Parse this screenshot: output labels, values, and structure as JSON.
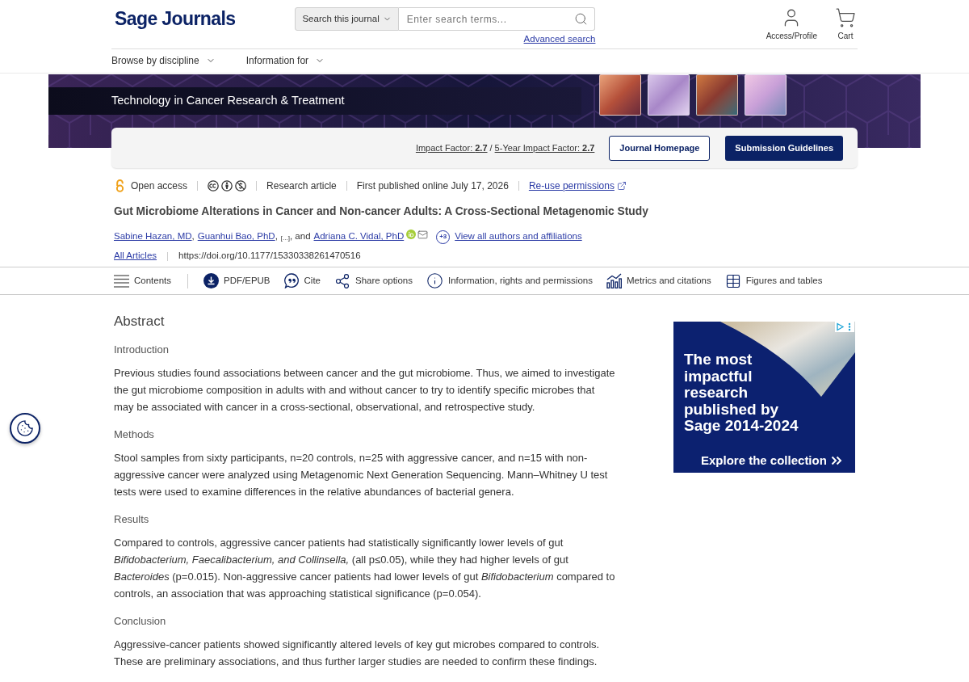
{
  "header": {
    "logo": "Sage Journals",
    "search": {
      "scope": "Search this journal",
      "placeholder": "Enter search terms..."
    },
    "advanced_search": "Advanced search",
    "actions": [
      {
        "kind": "profile",
        "label": "Access/Profile"
      },
      {
        "kind": "cart",
        "label": "Cart"
      }
    ]
  },
  "nav": [
    {
      "label": "Browse by discipline"
    },
    {
      "label": "Information for"
    }
  ],
  "banner": {
    "journal_title": "Technology in Cancer Research & Treatment",
    "metrics": [
      "Impact Factor: **2.7**",
      "5-Year Impact Factor: **2.7**"
    ],
    "metrics_separator": "/",
    "buttons": [
      {
        "kind": "outline",
        "label": "Journal Homepage"
      },
      {
        "kind": "primary",
        "label": "Submission Guidelines"
      }
    ]
  },
  "article_meta": {
    "access": "Open access",
    "type": "Research article",
    "published": "First published online July 17, 2026",
    "permissions": "Re-use permissions"
  },
  "title": "Gut Microbiome Alterations in Cancer and Non-cancer Adults: A Cross-Sectional Metagenomic Study",
  "author_line": [
    {
      "kind": "author",
      "text": "Sabine Hazan, MD"
    },
    {
      "kind": "text",
      "text": ","
    },
    {
      "kind": "author",
      "text": "Guanhui Bao, PhD"
    },
    {
      "kind": "text",
      "text": ","
    },
    {
      "kind": "collapsed",
      "text": "[...]"
    },
    {
      "kind": "text",
      "text": ", and"
    },
    {
      "kind": "author",
      "text": "Adriana C. Vidal, PhD"
    }
  ],
  "more_authors": "+3",
  "view_all": "View all authors and affiliations",
  "collection": "All Articles",
  "doi": "https://doi.org/10.1177/15330338261470516",
  "toolbar": [
    {
      "kind": "contents",
      "label": "Contents"
    },
    {
      "kind": "pdf",
      "label": "PDF/EPUB"
    },
    {
      "kind": "cite",
      "label": "Cite"
    },
    {
      "kind": "share",
      "label": "Share options"
    },
    {
      "kind": "info",
      "label": "Information, rights and permissions"
    },
    {
      "kind": "metrics",
      "label": "Metrics and citations"
    },
    {
      "kind": "figures",
      "label": "Figures and tables"
    }
  ],
  "abstract": {
    "heading": "Abstract",
    "sections": [
      {
        "heading": "Introduction",
        "text": "Previous studies found associations between cancer and the gut microbiome. Thus, we aimed to investigate the gut microbiome composition in adults with and without cancer to try to identify specific microbes that may be associated with cancer in a cross-sectional, observational, and retrospective study."
      },
      {
        "heading": "Methods",
        "text": "Stool samples from sixty participants, n=20 controls, n=25 with aggressive cancer, and n=15 with non-aggressive cancer were analyzed using Metagenomic Next Generation Sequencing. Mann–Whitney U test tests were used to examine differences in the relative abundances of bacterial genera."
      },
      {
        "heading": "Results",
        "text": "Compared to controls, aggressive cancer patients had statistically significantly lower levels of gut *Bifidobacterium, Faecalibacterium, and Collinsella,* (all p≤0.05), while they had higher levels of gut *Bacteroides* (p=0.015). Non-aggressive cancer patients had lower levels of gut *Bifidobacterium* compared to controls, an association that was approaching statistical significance (p=0.054)."
      },
      {
        "heading": "Conclusion",
        "text": "Aggressive-cancer patients showed significantly altered levels of key gut microbes compared to controls. These are preliminary associations, and thus further larger studies are needed to confirm these findings."
      }
    ]
  },
  "ad": {
    "headline": "The most impactful research published by Sage 2014-2024",
    "cta": "Explore the collection"
  }
}
